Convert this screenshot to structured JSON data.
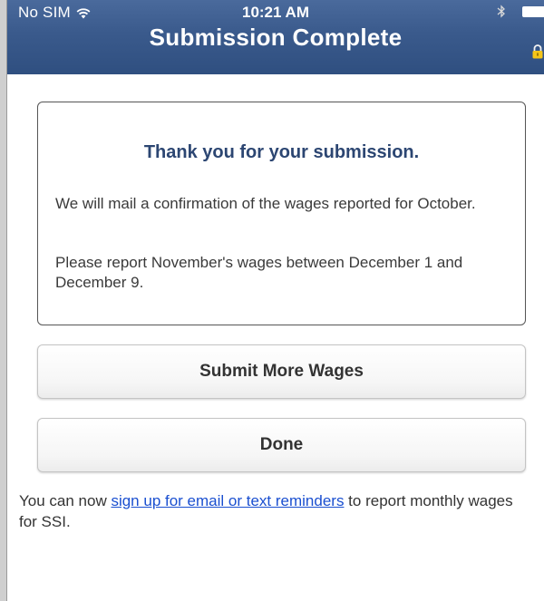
{
  "status_bar": {
    "carrier": "No SIM",
    "time": "10:21 AM"
  },
  "header": {
    "title": "Submission Complete"
  },
  "message_card": {
    "heading": "Thank you for your submission.",
    "paragraph_1": "We will mail a confirmation of the wages reported for October.",
    "paragraph_2": "Please report November's wages between December 1 and December 9."
  },
  "actions": {
    "submit_more_label": "Submit More Wages",
    "done_label": "Done"
  },
  "footer": {
    "prefix": "You can now ",
    "link_text": "sign up for email or text reminders",
    "suffix": " to report monthly wages for SSI."
  },
  "colors": {
    "header_bg": "#3a5a8c",
    "heading_text": "#2c4672",
    "link": "#1a4fd0"
  },
  "icons": [
    "wifi-icon",
    "bluetooth-icon",
    "battery-icon",
    "lock-icon"
  ]
}
